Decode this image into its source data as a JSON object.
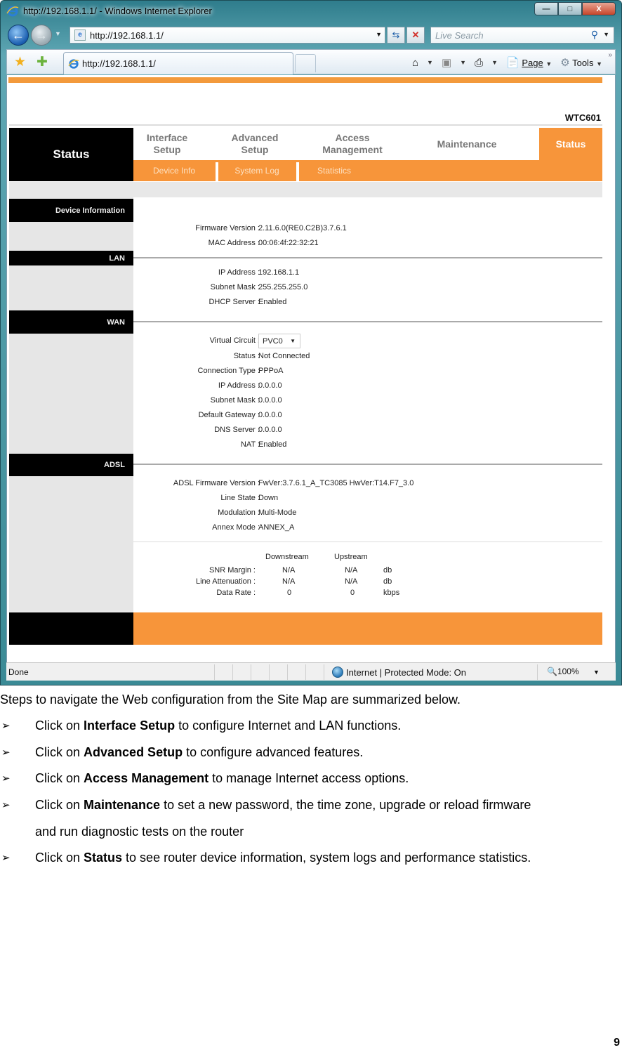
{
  "browser": {
    "window_title": "http://192.168.1.1/ - Windows Internet Explorer",
    "address": "http://192.168.1.1/",
    "search_placeholder": "Live Search",
    "tab_label": "http://192.168.1.1/",
    "tools": {
      "page_label": "Page",
      "tools_label": "Tools"
    },
    "window_buttons": {
      "minimize": "—",
      "maximize": "□",
      "close": "X"
    },
    "status": {
      "text": "Done",
      "zone": "Internet | Protected Mode: On",
      "zoom": "100%"
    }
  },
  "router": {
    "model": "WTC601",
    "logo_label": "Status",
    "main_nav": [
      {
        "label": "Interface\nSetup",
        "l1": "Interface",
        "l2": "Setup"
      },
      {
        "label": "Advanced\nSetup",
        "l1": "Advanced",
        "l2": "Setup"
      },
      {
        "label": "Access\nManagement",
        "l1": "Access",
        "l2": "Management"
      },
      {
        "label": "Maintenance",
        "l1": "Maintenance",
        "l2": ""
      },
      {
        "label": "Status",
        "l1": "Status",
        "l2": "",
        "active": true
      }
    ],
    "sub_nav": [
      "Device Info",
      "System Log",
      "Statistics"
    ],
    "sections": {
      "device": {
        "title": "Device Information",
        "rows": [
          {
            "label": "Firmware Version :",
            "value": "2.11.6.0(RE0.C2B)3.7.6.1"
          },
          {
            "label": "MAC Address :",
            "value": "00:06:4f:22:32:21"
          }
        ]
      },
      "lan": {
        "title": "LAN",
        "rows": [
          {
            "label": "IP Address :",
            "value": "192.168.1.1"
          },
          {
            "label": "Subnet Mask :",
            "value": "255.255.255.0"
          },
          {
            "label": "DHCP Server :",
            "value": "Enabled"
          }
        ]
      },
      "wan": {
        "title": "WAN",
        "virtual_circuit_label": "Virtual Circuit :",
        "virtual_circuit_value": "PVC0",
        "rows": [
          {
            "label": "Status :",
            "value": "Not Connected"
          },
          {
            "label": "Connection Type :",
            "value": "PPPoA"
          },
          {
            "label": "IP Address :",
            "value": "0.0.0.0"
          },
          {
            "label": "Subnet Mask :",
            "value": "0.0.0.0"
          },
          {
            "label": "Default Gateway :",
            "value": "0.0.0.0"
          },
          {
            "label": "DNS Server :",
            "value": "0.0.0.0"
          },
          {
            "label": "NAT :",
            "value": "Enabled"
          }
        ]
      },
      "adsl": {
        "title": "ADSL",
        "rows": [
          {
            "label": "ADSL Firmware Version :",
            "value": "FwVer:3.7.6.1_A_TC3085 HwVer:T14.F7_3.0"
          },
          {
            "label": "Line State :",
            "value": "Down"
          },
          {
            "label": "Modulation :",
            "value": "Multi-Mode"
          },
          {
            "label": "Annex Mode :",
            "value": "ANNEX_A"
          }
        ],
        "stats": {
          "headers": [
            "Downstream",
            "Upstream"
          ],
          "rows": [
            {
              "label": "SNR Margin :",
              "down": "N/A",
              "up": "N/A",
              "unit": "db"
            },
            {
              "label": "Line Attenuation :",
              "down": "N/A",
              "up": "N/A",
              "unit": "db"
            },
            {
              "label": "Data Rate :",
              "down": "0",
              "up": "0",
              "unit": "kbps"
            }
          ]
        }
      }
    }
  },
  "document": {
    "intro": "Steps to navigate the Web configuration from the Site Map are summarized below.",
    "bullet_glyph": "➢",
    "items": [
      {
        "pre": "Click on ",
        "bold": "Interface Setup",
        "post": " to configure Internet and LAN functions."
      },
      {
        "pre": "Click on ",
        "bold": "Advanced Setup",
        "post": " to configure advanced features."
      },
      {
        "pre": "Click on ",
        "bold": "Access Management",
        "post": " to manage Internet access options."
      },
      {
        "pre": "Click on ",
        "bold": "Maintenance",
        "post": " to set a new password, the time zone, upgrade or reload firmware",
        "cont": "and run diagnostic tests on the router"
      },
      {
        "pre": "Click on ",
        "bold": "Status",
        "post": " to see router device information, system logs and performance statistics."
      }
    ],
    "page_number": "9"
  }
}
